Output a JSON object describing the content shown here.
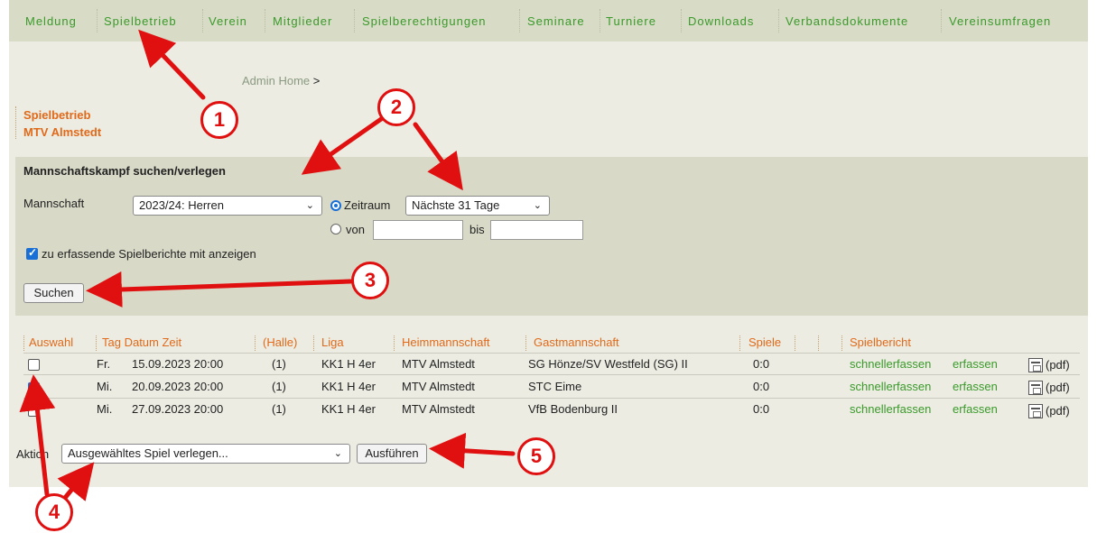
{
  "nav": [
    "Meldung",
    "Spielbetrieb",
    "Verein",
    "Mitglieder",
    "Spielberechtigungen",
    "Seminare",
    "Turniere",
    "Downloads",
    "Verbandsdokumente",
    "Vereinsumfragen"
  ],
  "breadcrumb": {
    "link": "Admin Home",
    "sep": ">"
  },
  "section": {
    "title": "Spielbetrieb",
    "club": "MTV Almstedt"
  },
  "search": {
    "heading": "Mannschaftskampf suchen/verlegen",
    "team_label": "Mannschaft",
    "team_value": "2023/24: Herren",
    "period_label": "Zeitraum",
    "period_value": "Nächste 31 Tage",
    "from_label": "von",
    "to_label": "bis",
    "from_value": "",
    "to_value": "",
    "show_reports_label": "zu erfassende Spielberichte mit anzeigen",
    "search_button": "Suchen"
  },
  "table": {
    "headers": {
      "select": "Auswahl",
      "date": "Tag Datum Zeit",
      "hall": "(Halle)",
      "league": "Liga",
      "home": "Heimmannschaft",
      "guest": "Gastmannschaft",
      "games": "Spiele",
      "report": "Spielbericht"
    },
    "rows": [
      {
        "day": "Fr.",
        "date": "15.09.2023 20:00",
        "hall": "(1)",
        "league": "KK1 H 4er",
        "home": "MTV Almstedt",
        "guest": "SG Hönze/SV Westfeld (SG) II",
        "games": "0:0",
        "quick": "schnellerfassen",
        "enter": "erfassen",
        "pdf": "(pdf)",
        "checked": false
      },
      {
        "day": "Mi.",
        "date": "20.09.2023 20:00",
        "hall": "(1)",
        "league": "KK1 H 4er",
        "home": "MTV Almstedt",
        "guest": "STC Eime",
        "games": "0:0",
        "quick": "schnellerfassen",
        "enter": "erfassen",
        "pdf": "(pdf)",
        "checked": true
      },
      {
        "day": "Mi.",
        "date": "27.09.2023 20:00",
        "hall": "(1)",
        "league": "KK1 H 4er",
        "home": "MTV Almstedt",
        "guest": "VfB Bodenburg II",
        "games": "0:0",
        "quick": "schnellerfassen",
        "enter": "erfassen",
        "pdf": "(pdf)",
        "checked": false
      }
    ]
  },
  "action": {
    "label": "Aktion",
    "value": "Ausgewähltes Spiel verlegen...",
    "button": "Ausführen"
  },
  "callouts": [
    "1",
    "2",
    "3",
    "4",
    "5"
  ],
  "colors": {
    "nav_bg": "#d8dbc6",
    "link_green": "#3a9a2a",
    "orange": "#e06a1a",
    "callout_red": "#e01010",
    "checkbox_blue": "#1a6fd6"
  }
}
